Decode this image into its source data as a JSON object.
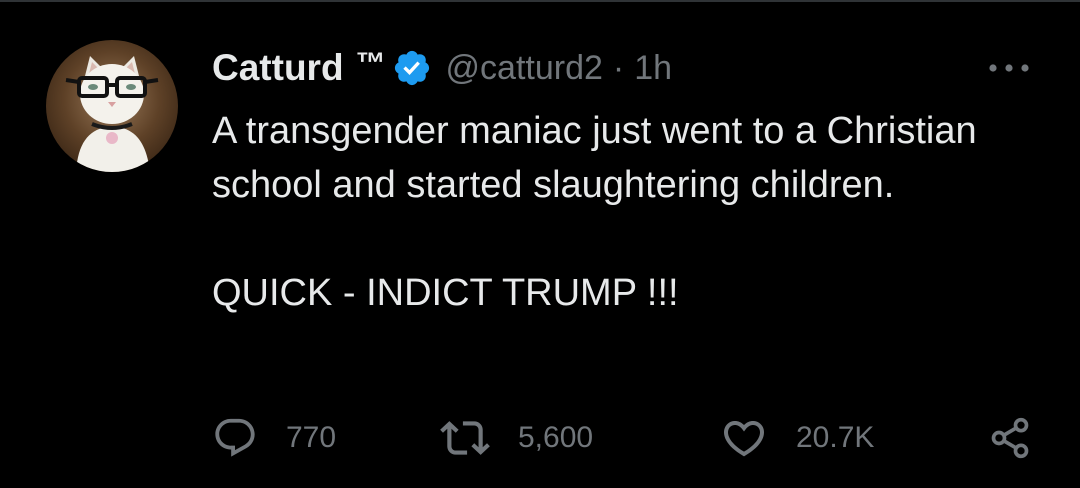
{
  "user": {
    "display_name": "Catturd",
    "tm_symbol": "™",
    "handle": "@catturd2",
    "separator": "·",
    "time": "1h",
    "verified_color": "#1d9bf0"
  },
  "tweet": {
    "paragraphs": [
      "A transgender maniac just went to a Christian school and started slaughtering children.",
      "QUICK - INDICT TRUMP !!!"
    ]
  },
  "actions": {
    "replies": "770",
    "retweets": "5,600",
    "likes": "20.7K"
  },
  "icons": {
    "more": "more-horizontal-icon",
    "reply": "reply-icon",
    "retweet": "retweet-icon",
    "like": "heart-icon",
    "share": "share-icon"
  },
  "colors": {
    "background": "#000000",
    "text": "#e7e9ea",
    "muted": "#71767b"
  }
}
